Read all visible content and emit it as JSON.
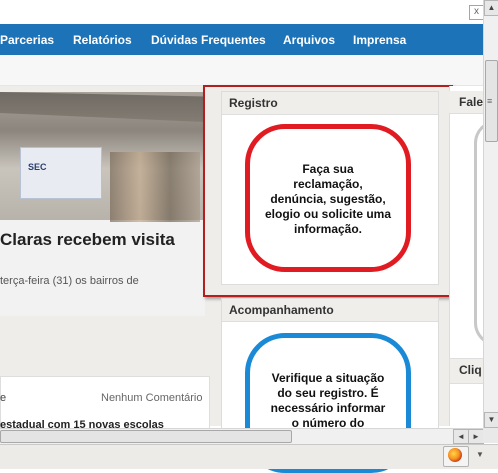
{
  "nav": {
    "items": [
      "Parcerias",
      "Relatórios",
      "Dúvidas Frequentes",
      "Arquivos",
      "Imprensa"
    ]
  },
  "feature": {
    "banner_text": "SEC",
    "headline": "Claras recebem visita",
    "subline": "terça-feira (31) os bairros de"
  },
  "news": {
    "prefix": "e",
    "comment": "Nenhum Comentário",
    "title": "estadual com 15 novas escolas"
  },
  "registro": {
    "title": "Registro",
    "message_lines": [
      "Faça sua",
      "reclamação,",
      "denúncia, sugestão,",
      "elogio ou solicite uma",
      "informação."
    ],
    "bubble_color": "#e11b22"
  },
  "acompanhamento": {
    "title": "Acompanhamento",
    "message_lines": [
      "Verifique a situação",
      "do seu registro. É",
      "necessário informar",
      "o número do"
    ],
    "bubble_color": "#1b8ad6"
  },
  "right": {
    "fale_title": "Fale",
    "cliq_title": "Cliq"
  },
  "window": {
    "close_glyph": "x",
    "nav_color": "#1d73b8"
  },
  "icons": {
    "scroll_up": "▲",
    "scroll_down": "▼",
    "scroll_left": "◄",
    "scroll_right": "►",
    "grip": "≡",
    "dropdown": "▼"
  }
}
